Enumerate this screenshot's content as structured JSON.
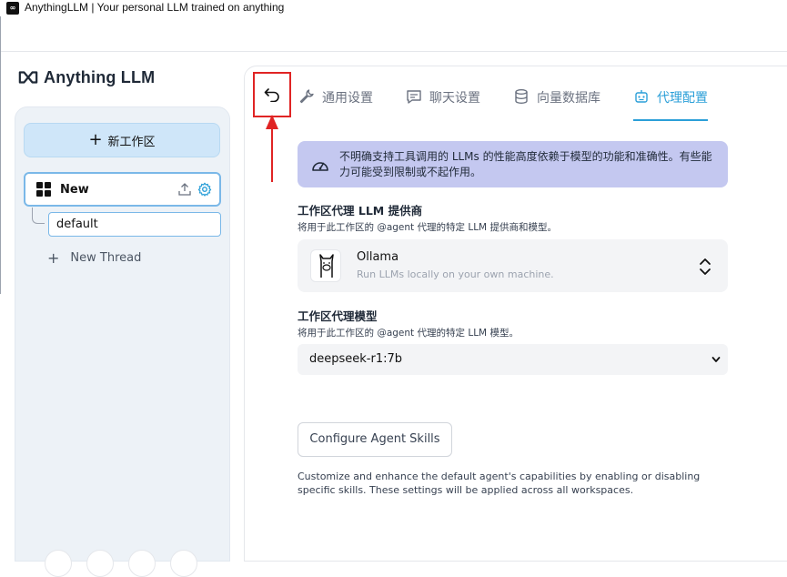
{
  "window": {
    "title": "AnythingLLM | Your personal LLM trained on anything",
    "icon": "app-logo-icon"
  },
  "brand": {
    "name": "Anything LLM"
  },
  "sidebar": {
    "new_workspace_label": "新工作区",
    "workspace": {
      "name": "New"
    },
    "thread": {
      "name": "default"
    },
    "new_thread_label": "New Thread"
  },
  "tabs": [
    {
      "label": "通用设置",
      "icon": "wrench-icon",
      "active": false
    },
    {
      "label": "聊天设置",
      "icon": "chat-icon",
      "active": false
    },
    {
      "label": "向量数据库",
      "icon": "database-icon",
      "active": false
    },
    {
      "label": "代理配置",
      "icon": "robot-icon",
      "active": true
    }
  ],
  "notice": {
    "text": "不明确支持工具调用的 LLMs 的性能高度依赖于模型的功能和准确性。有些能力可能受到限制或不起作用。"
  },
  "provider": {
    "title": "工作区代理 LLM 提供商",
    "subtitle": "将用于此工作区的 @agent 代理的特定 LLM 提供商和模型。",
    "name": "Ollama",
    "description": "Run LLMs locally on your own machine."
  },
  "model": {
    "title": "工作区代理模型",
    "subtitle": "将用于此工作区的 @agent 代理的特定 LLM 模型。",
    "value": "deepseek-r1:7b"
  },
  "skills": {
    "button_label": "Configure Agent Skills",
    "description": "Customize and enhance the default agent's capabilities by enabling or disabling specific skills. These settings will be applied across all workspaces."
  },
  "colors": {
    "accent": "#2b9fd8",
    "annotation": "#e02424",
    "notice_bg": "#c4c8f0"
  }
}
